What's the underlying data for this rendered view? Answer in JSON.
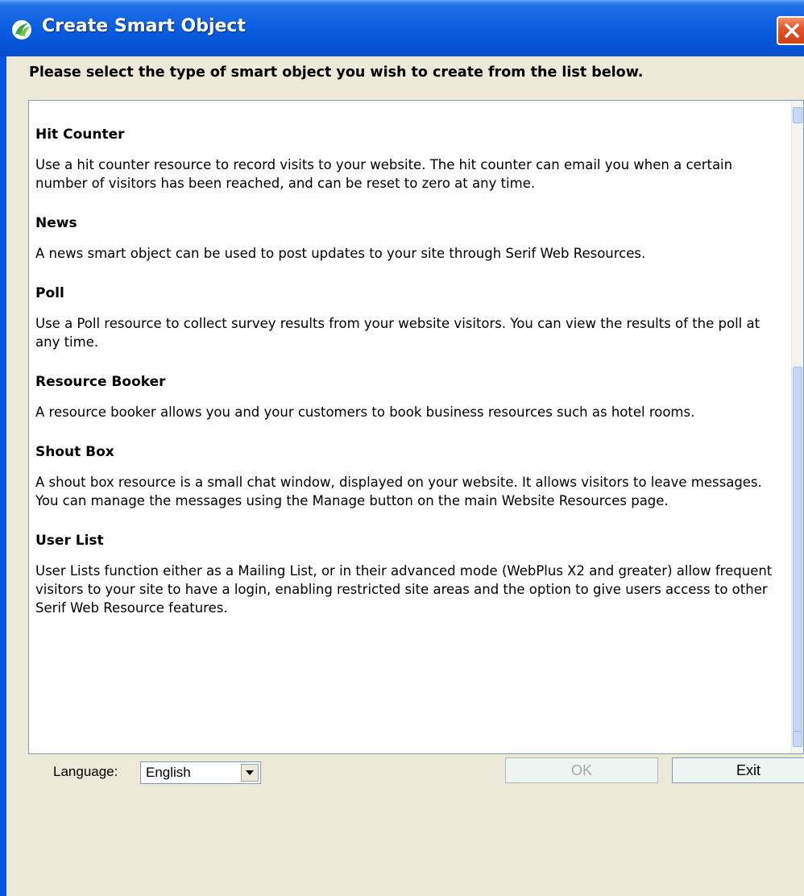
{
  "window": {
    "title": "Create Smart Object",
    "instruction": "Please select the type of smart object you wish to create from the list below."
  },
  "items": [
    {
      "title": "Hit Counter",
      "description": "Use a hit counter resource to record visits to your website. The hit counter can email you when a certain number of visitors has been reached, and can be reset to zero at any time."
    },
    {
      "title": "News",
      "description": "A news smart object can be used to post updates to your site through Serif Web Resources."
    },
    {
      "title": "Poll",
      "description": "Use a Poll resource to collect survey results from your website visitors. You can view the results of the poll at any time."
    },
    {
      "title": "Resource Booker",
      "description": "A resource booker allows you and your customers to book business resources such as hotel rooms."
    },
    {
      "title": "Shout Box",
      "description": "A shout box resource is a small chat window, displayed on your website. It allows visitors to leave messages. You can manage the messages using the Manage button on the main Website Resources page."
    },
    {
      "title": "User List",
      "description": "User Lists function either as a Mailing List, or in their advanced mode (WebPlus X2 and greater) allow frequent visitors to your site to have a login, enabling restricted site areas and the option to give users access to other Serif Web Resource features."
    }
  ],
  "footer": {
    "language_label": "Language:",
    "language_value": "English",
    "ok_label": "OK",
    "exit_label": "Exit"
  },
  "colors": {
    "titlebar": "#0a5ddf",
    "close_button": "#e2542a",
    "dialog_background": "#ece9d8"
  }
}
